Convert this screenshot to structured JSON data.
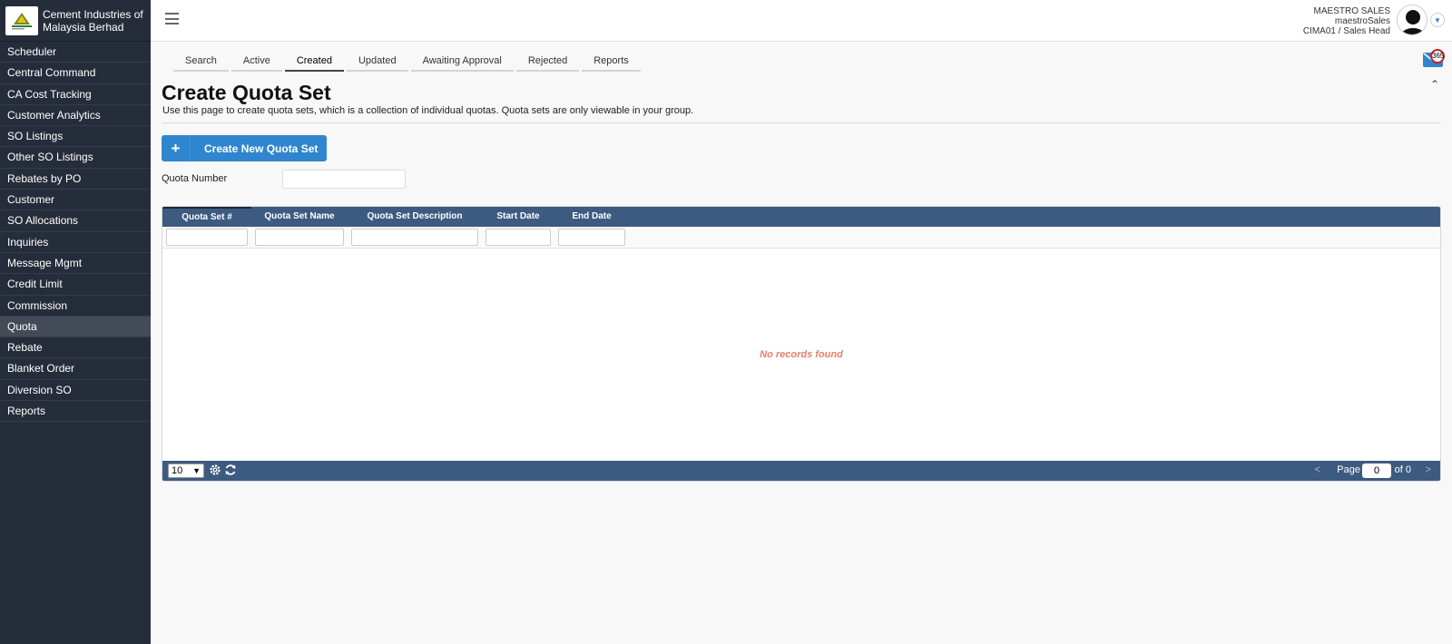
{
  "brand": {
    "name": "Cement Industries of Malaysia Berhad"
  },
  "sidebar": {
    "items": [
      {
        "label": "Scheduler"
      },
      {
        "label": "Central Command"
      },
      {
        "label": "CA Cost Tracking"
      },
      {
        "label": "Customer Analytics"
      },
      {
        "label": "SO Listings"
      },
      {
        "label": "Other SO Listings"
      },
      {
        "label": "Rebates by PO"
      },
      {
        "label": "Customer"
      },
      {
        "label": "SO Allocations"
      },
      {
        "label": "Inquiries"
      },
      {
        "label": "Message Mgmt"
      },
      {
        "label": "Credit Limit"
      },
      {
        "label": "Commission"
      },
      {
        "label": "Quota",
        "active": true
      },
      {
        "label": "Rebate"
      },
      {
        "label": "Blanket Order"
      },
      {
        "label": "Diversion SO"
      },
      {
        "label": "Reports"
      }
    ]
  },
  "user": {
    "display_name": "MAESTRO SALES",
    "username": "maestroSales",
    "role": "CIMA01 / Sales Head"
  },
  "tabs": [
    {
      "label": "Search"
    },
    {
      "label": "Active"
    },
    {
      "label": "Created",
      "active": true
    },
    {
      "label": "Updated"
    },
    {
      "label": "Awaiting Approval"
    },
    {
      "label": "Rejected"
    },
    {
      "label": "Reports"
    }
  ],
  "notifications": {
    "count": "365"
  },
  "page": {
    "title": "Create Quota Set",
    "description": "Use this page to create quota sets, which is a collection of individual quotas. Quota sets are only viewable in your group.",
    "create_button": "Create New Quota Set",
    "quota_number_label": "Quota Number",
    "quota_number_value": ""
  },
  "grid": {
    "columns": [
      {
        "label": "Quota Set #"
      },
      {
        "label": "Quota Set Name"
      },
      {
        "label": "Quota Set Description"
      },
      {
        "label": "Start Date"
      },
      {
        "label": "End Date"
      }
    ],
    "empty_message": "No records found",
    "footer": {
      "page_size": "10",
      "prev": "<",
      "page_label": "Page",
      "page_value": "0",
      "page_of": "of 0",
      "next": ">"
    }
  },
  "colors": {
    "sidebar_bg": "#262d3a",
    "grid_header_bg": "#3d5b80",
    "primary_button": "#2f86cf",
    "empty_message": "#e67e68"
  },
  "icons": {
    "menu": "hamburger-icon",
    "mail": "mail-icon",
    "collapse": "chevron-up-icon",
    "settings": "gear-icon",
    "refresh": "refresh-icon",
    "add": "plus-icon"
  }
}
